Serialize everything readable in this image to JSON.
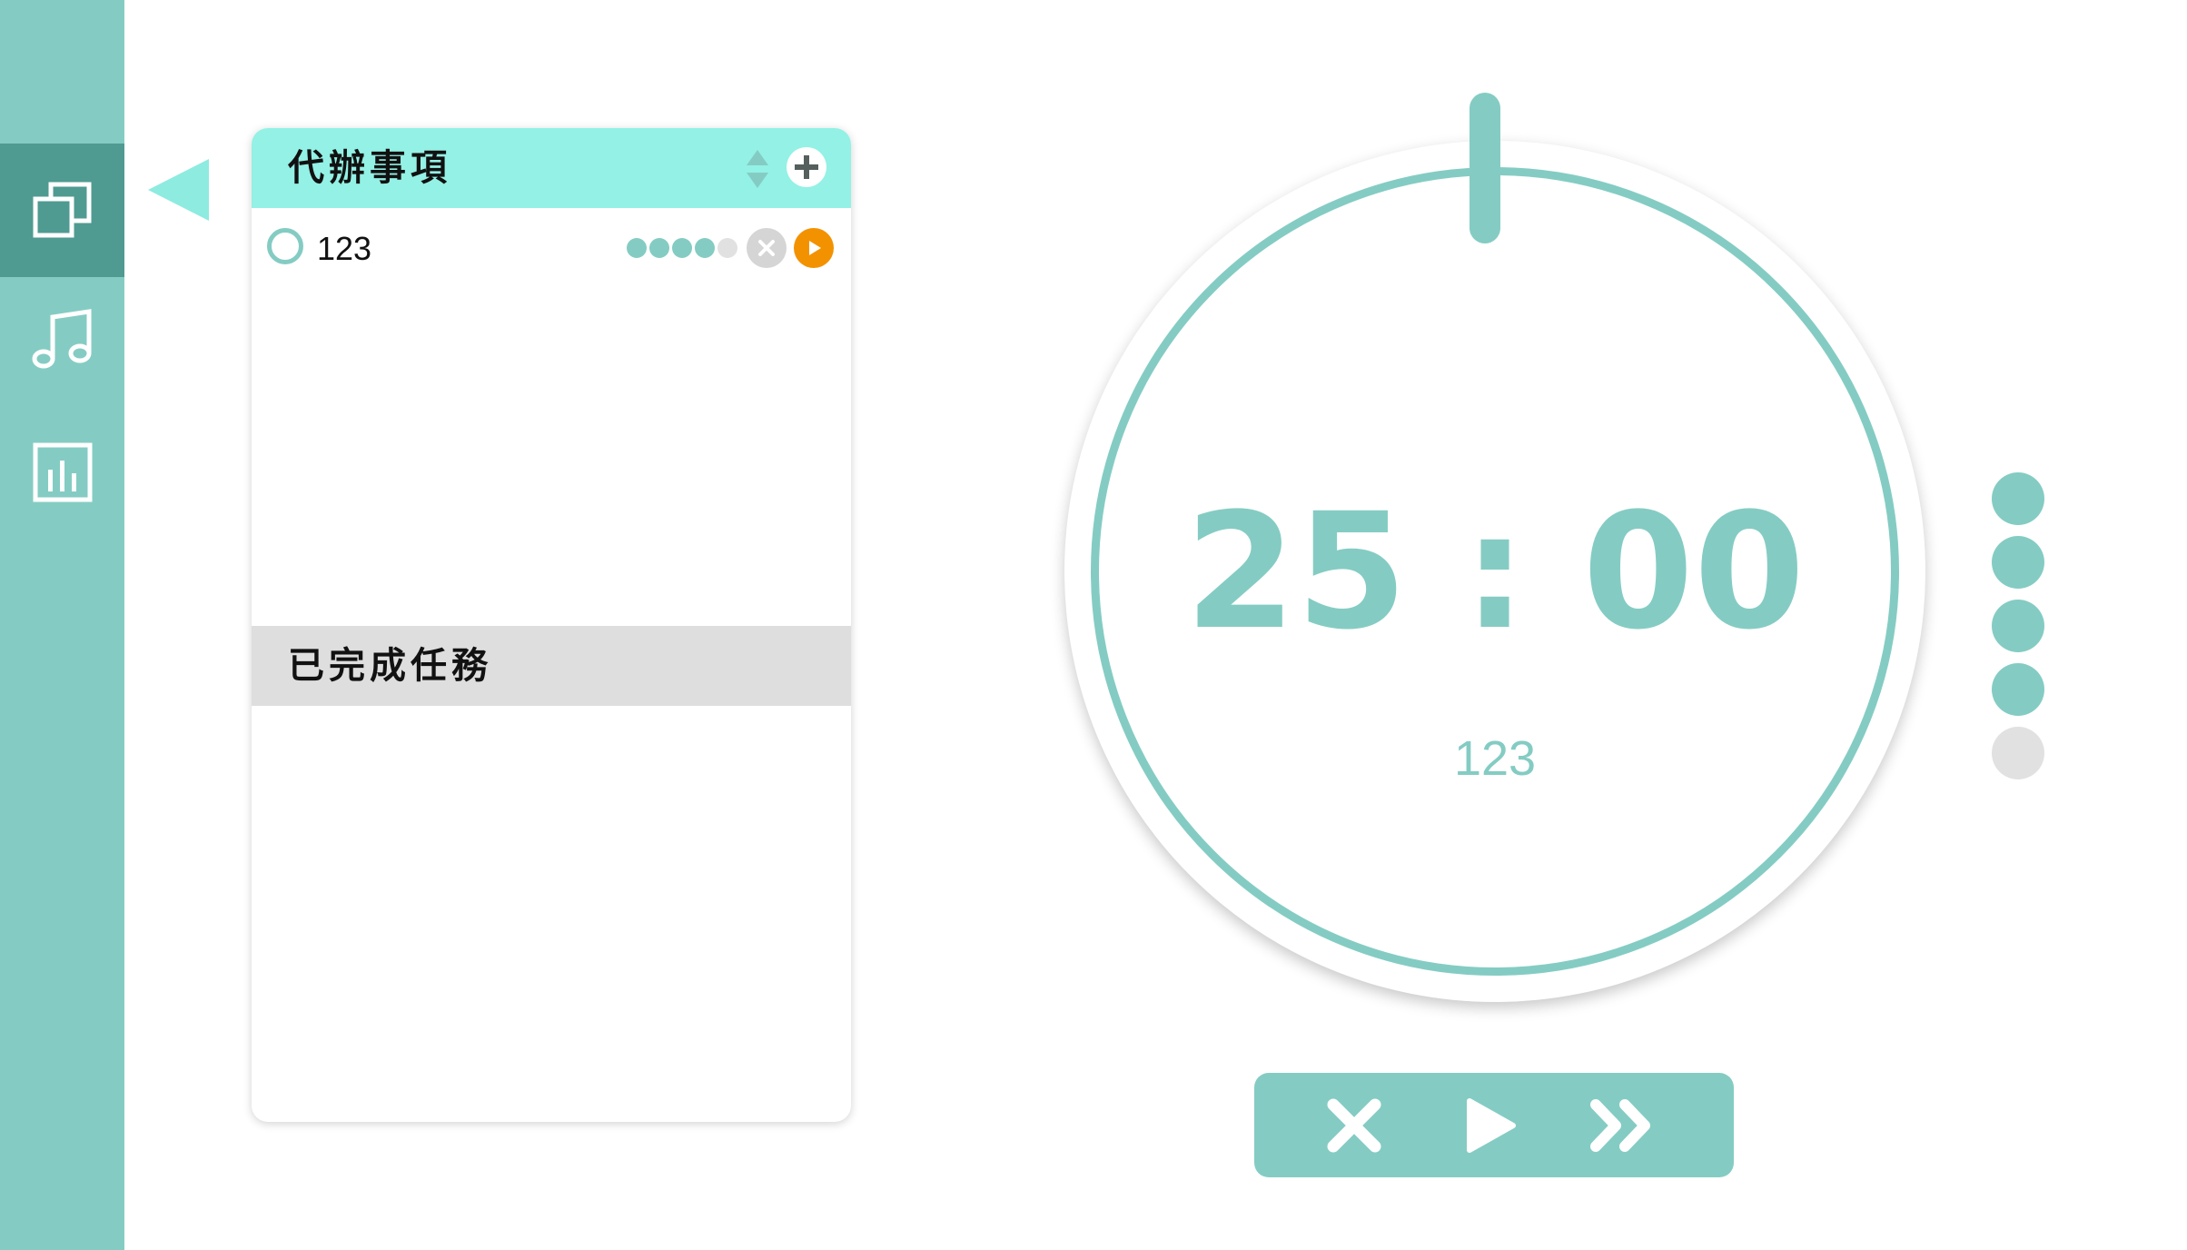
{
  "sidebar": {
    "items": [
      {
        "name": "tasks",
        "icon": "copy-squares-icon",
        "active": true
      },
      {
        "name": "music",
        "icon": "music-note-icon",
        "active": false
      },
      {
        "name": "stats",
        "icon": "bar-chart-icon",
        "active": false
      }
    ]
  },
  "todo_panel": {
    "title": "代辦事項",
    "sort_icon": "sort-arrows-icon",
    "add_icon": "plus-circle-icon",
    "tasks": [
      {
        "name": "123",
        "pomodoros_done": 4,
        "pomodoros_total": 5
      }
    ]
  },
  "done_panel": {
    "title": "已完成任務",
    "tasks": []
  },
  "timer": {
    "minutes": "25",
    "separator": ":",
    "seconds": "00",
    "display": "25 : 00",
    "current_task": "123",
    "progress_done": 4,
    "progress_total": 5
  },
  "controls": {
    "cancel_icon": "close-x-icon",
    "play_icon": "play-icon",
    "skip_icon": "skip-forward-icon"
  },
  "colors": {
    "accent": "#84ccc3",
    "accent_dark": "#4f9b91",
    "header": "#93f1e5",
    "done_header": "#dedede",
    "play": "#f39200",
    "inactive": "#e1e1e1"
  }
}
